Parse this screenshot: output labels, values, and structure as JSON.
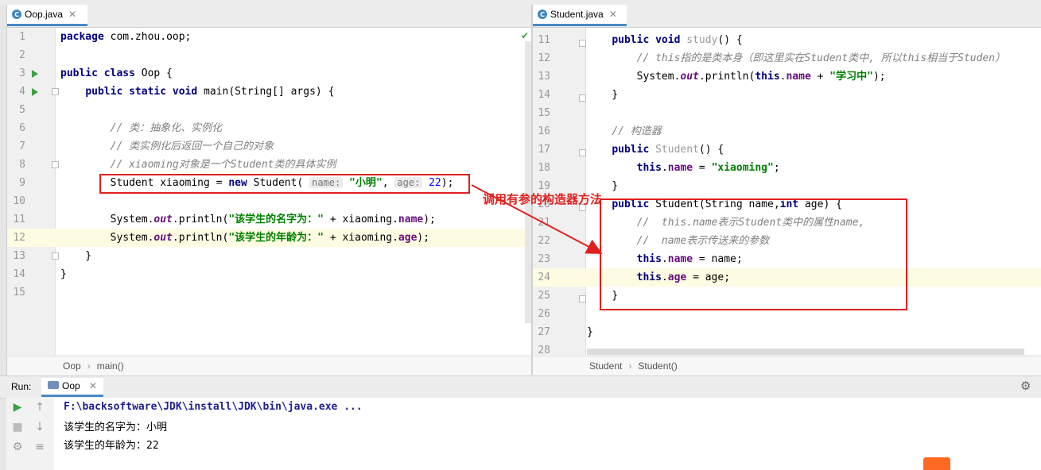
{
  "left_tab": {
    "label": "Oop.java",
    "icon": "class-icon"
  },
  "right_tab": {
    "label": "Student.java",
    "icon": "class-icon"
  },
  "left_lines": [
    {
      "n": "1",
      "html": "<span class='kw'>package</span> com.zhou.oop;"
    },
    {
      "n": "2",
      "html": ""
    },
    {
      "n": "3",
      "html": "<span class='kw'>public class</span> Oop {"
    },
    {
      "n": "4",
      "html": "    <span class='kw'>public static void</span> main(String[] args) {"
    },
    {
      "n": "5",
      "html": ""
    },
    {
      "n": "6",
      "html": "        <span class='cm'>// 类：抽象化、实例化</span>"
    },
    {
      "n": "7",
      "html": "        <span class='cm'>// 类实例化后返回一个自己的对象</span>"
    },
    {
      "n": "8",
      "html": "        <span class='cm'>// xiaoming对象是一个Student类的具体实例</span>"
    },
    {
      "n": "9",
      "html": "        Student xiaoming = <span class='kw'>new</span> Student( <span class='hint'>name:</span> <span class='st'>\"小明\"</span>, <span class='hint'>age:</span> <span class='num'>22</span>);"
    },
    {
      "n": "10",
      "html": ""
    },
    {
      "n": "11",
      "html": "        System.<span class='fd it'>out</span>.println(<span class='st'>\"该学生的名字为：\"</span> + xiaoming.<span class='fd'>name</span>);"
    },
    {
      "n": "12",
      "html": "        System.<span class='fd it'>out</span>.println(<span class='st'>\"该学生的年龄为：\"</span> + xiaoming.<span class='fd'>age</span>);"
    },
    {
      "n": "13",
      "html": "    }"
    },
    {
      "n": "14",
      "html": "}"
    },
    {
      "n": "15",
      "html": ""
    }
  ],
  "right_lines": [
    {
      "n": "11",
      "html": "    <span class='kw'>public void</span> <span class='gray'>study</span>() {"
    },
    {
      "n": "12",
      "html": "        <span class='cm'>// this指的是类本身（即这里实在Student类中, 所以this相当于Studen）</span>"
    },
    {
      "n": "13",
      "html": "        System.<span class='fd it'>out</span>.println(<span class='kw'>this</span>.<span class='fd'>name</span> + <span class='st'>\"学习中\"</span>);"
    },
    {
      "n": "14",
      "html": "    }"
    },
    {
      "n": "15",
      "html": ""
    },
    {
      "n": "16",
      "html": "    <span class='cm'>// 构造器</span>"
    },
    {
      "n": "17",
      "html": "    <span class='kw'>public</span> <span class='gray'>Student</span>() {"
    },
    {
      "n": "18",
      "html": "        <span class='kw'>this</span>.<span class='fd'>name</span> = <span class='st'>\"xiaoming\"</span>;"
    },
    {
      "n": "19",
      "html": "    }"
    },
    {
      "n": "20",
      "html": "    <span class='kw'>public</span> Student(String name,<span class='kw'>int</span> age) {"
    },
    {
      "n": "21",
      "html": "        <span class='cm'>//  this.name表示Student类中的属性name,</span>"
    },
    {
      "n": "22",
      "html": "        <span class='cm'>//  name表示传送来的参数</span>"
    },
    {
      "n": "23",
      "html": "        <span class='kw'>this</span>.<span class='fd'>name</span> = name;"
    },
    {
      "n": "24",
      "html": "        <span class='kw'>this</span>.<span class='fd'>age</span> = age;"
    },
    {
      "n": "25",
      "html": "    }"
    },
    {
      "n": "26",
      "html": ""
    },
    {
      "n": "27",
      "html": "}"
    },
    {
      "n": "28",
      "html": ""
    }
  ],
  "left_breadcrumb": {
    "a": "Oop",
    "b": "main()"
  },
  "right_breadcrumb": {
    "a": "Student",
    "b": "Student()"
  },
  "annotation": "调用有参的构造器方法",
  "run": {
    "label": "Run:",
    "tab": "Oop"
  },
  "console": {
    "cmd": "F:\\backsoftware\\JDK\\install\\JDK\\bin\\java.exe ...",
    "out1": "该学生的名字为：小明",
    "out2": "该学生的年龄为：22"
  },
  "colors": {
    "annotation": "#e02020",
    "accent": "#4a88c7"
  }
}
